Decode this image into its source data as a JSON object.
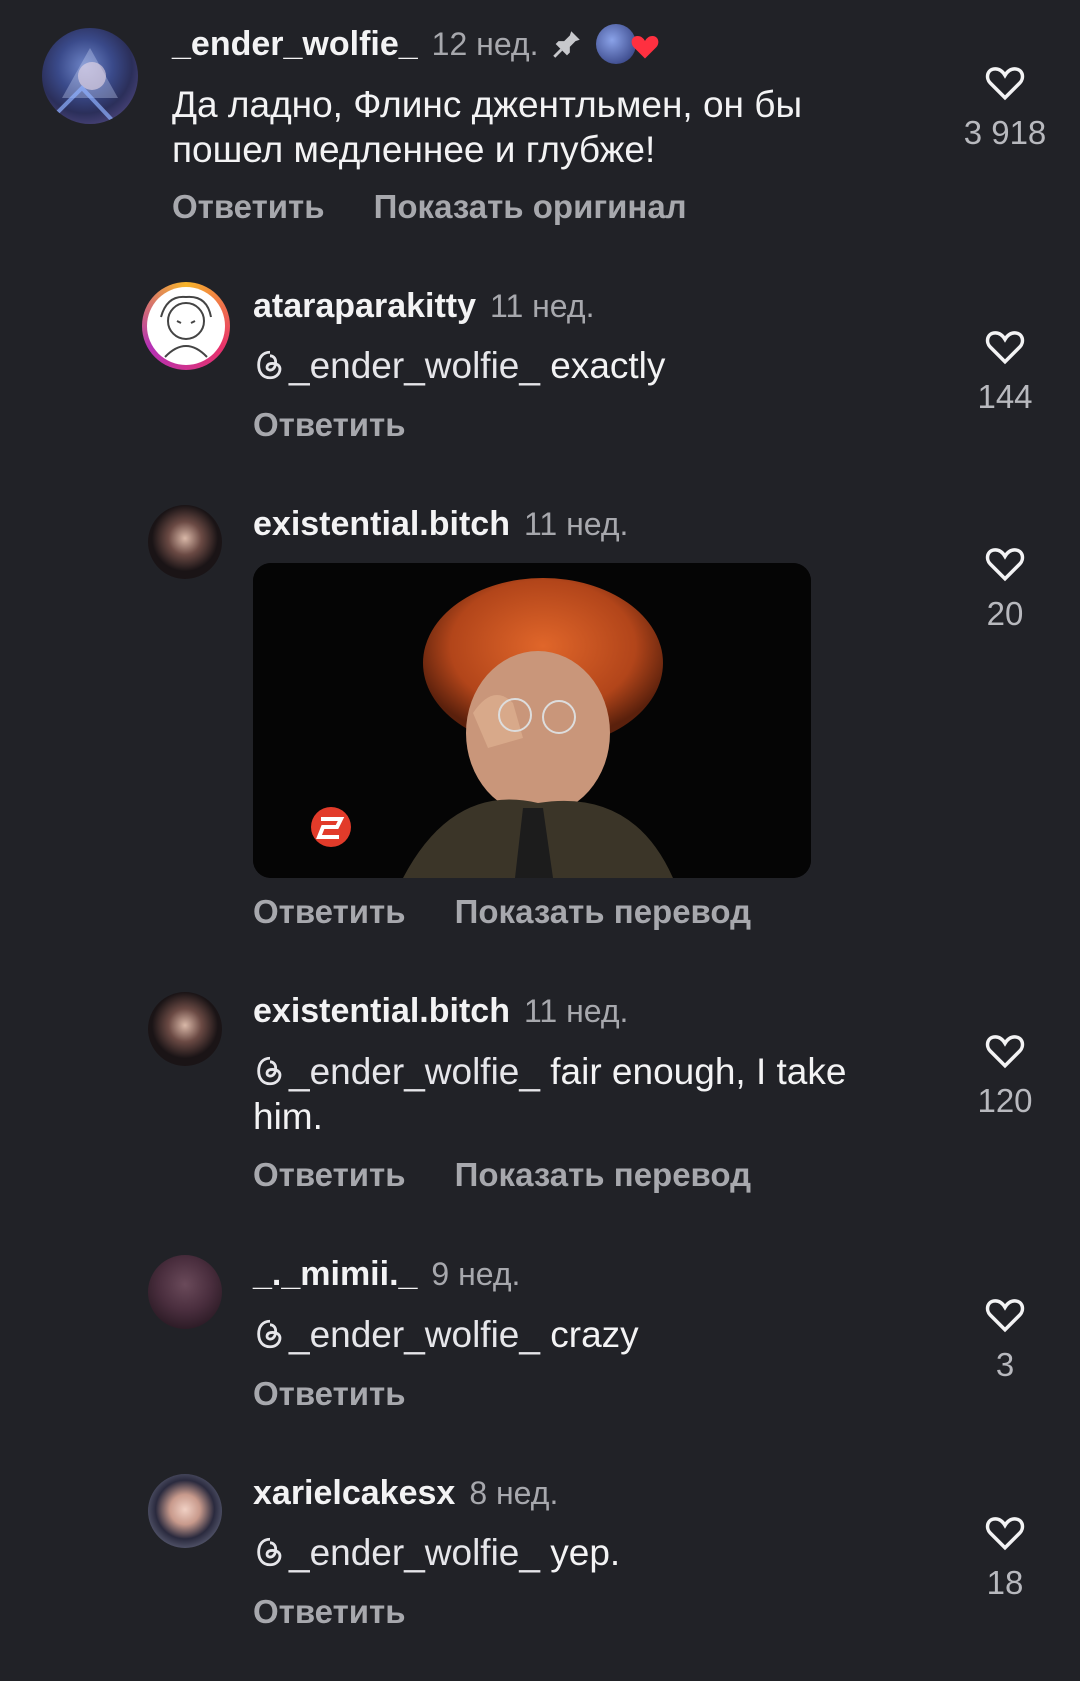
{
  "comments": [
    {
      "username": "_ender_wolfie_",
      "time": "12 нед.",
      "text": "Да ладно, Флинс джентльмен, он бы пошел медленнее и глубже!",
      "actions": [
        "Ответить",
        "Показать оригинал"
      ],
      "likes": "3 918",
      "pinned": true,
      "liked_by_creator": true
    },
    {
      "username": "ataraparakitty",
      "time": "11 нед.",
      "mention": "_ender_wolfie_",
      "text": " exactly",
      "actions": [
        "Ответить"
      ],
      "likes": "144"
    },
    {
      "username": "existential.bitch",
      "time": "11 нед.",
      "media": "gif",
      "actions": [
        "Ответить",
        "Показать перевод"
      ],
      "likes": "20"
    },
    {
      "username": "existential.bitch",
      "time": "11 нед.",
      "mention": "_ender_wolfie_",
      "text": " fair enough, I take him.",
      "actions": [
        "Ответить",
        "Показать перевод"
      ],
      "likes": "120"
    },
    {
      "username": "_._mimii._",
      "time": "9 нед.",
      "mention": "_ender_wolfie_",
      "text": " crazy",
      "actions": [
        "Ответить"
      ],
      "likes": "3"
    },
    {
      "username": "xarielcakesx",
      "time": "8 нед.",
      "mention": "_ender_wolfie_",
      "text": " yep.",
      "actions": [
        "Ответить"
      ],
      "likes": "18"
    }
  ],
  "colors": {
    "background": "#212227",
    "heart_red": "#ff3040",
    "muted": "#a7a8ad"
  },
  "icons": {
    "like": "heart-outline-icon",
    "pin": "pin-icon",
    "mention": "threads-icon"
  }
}
